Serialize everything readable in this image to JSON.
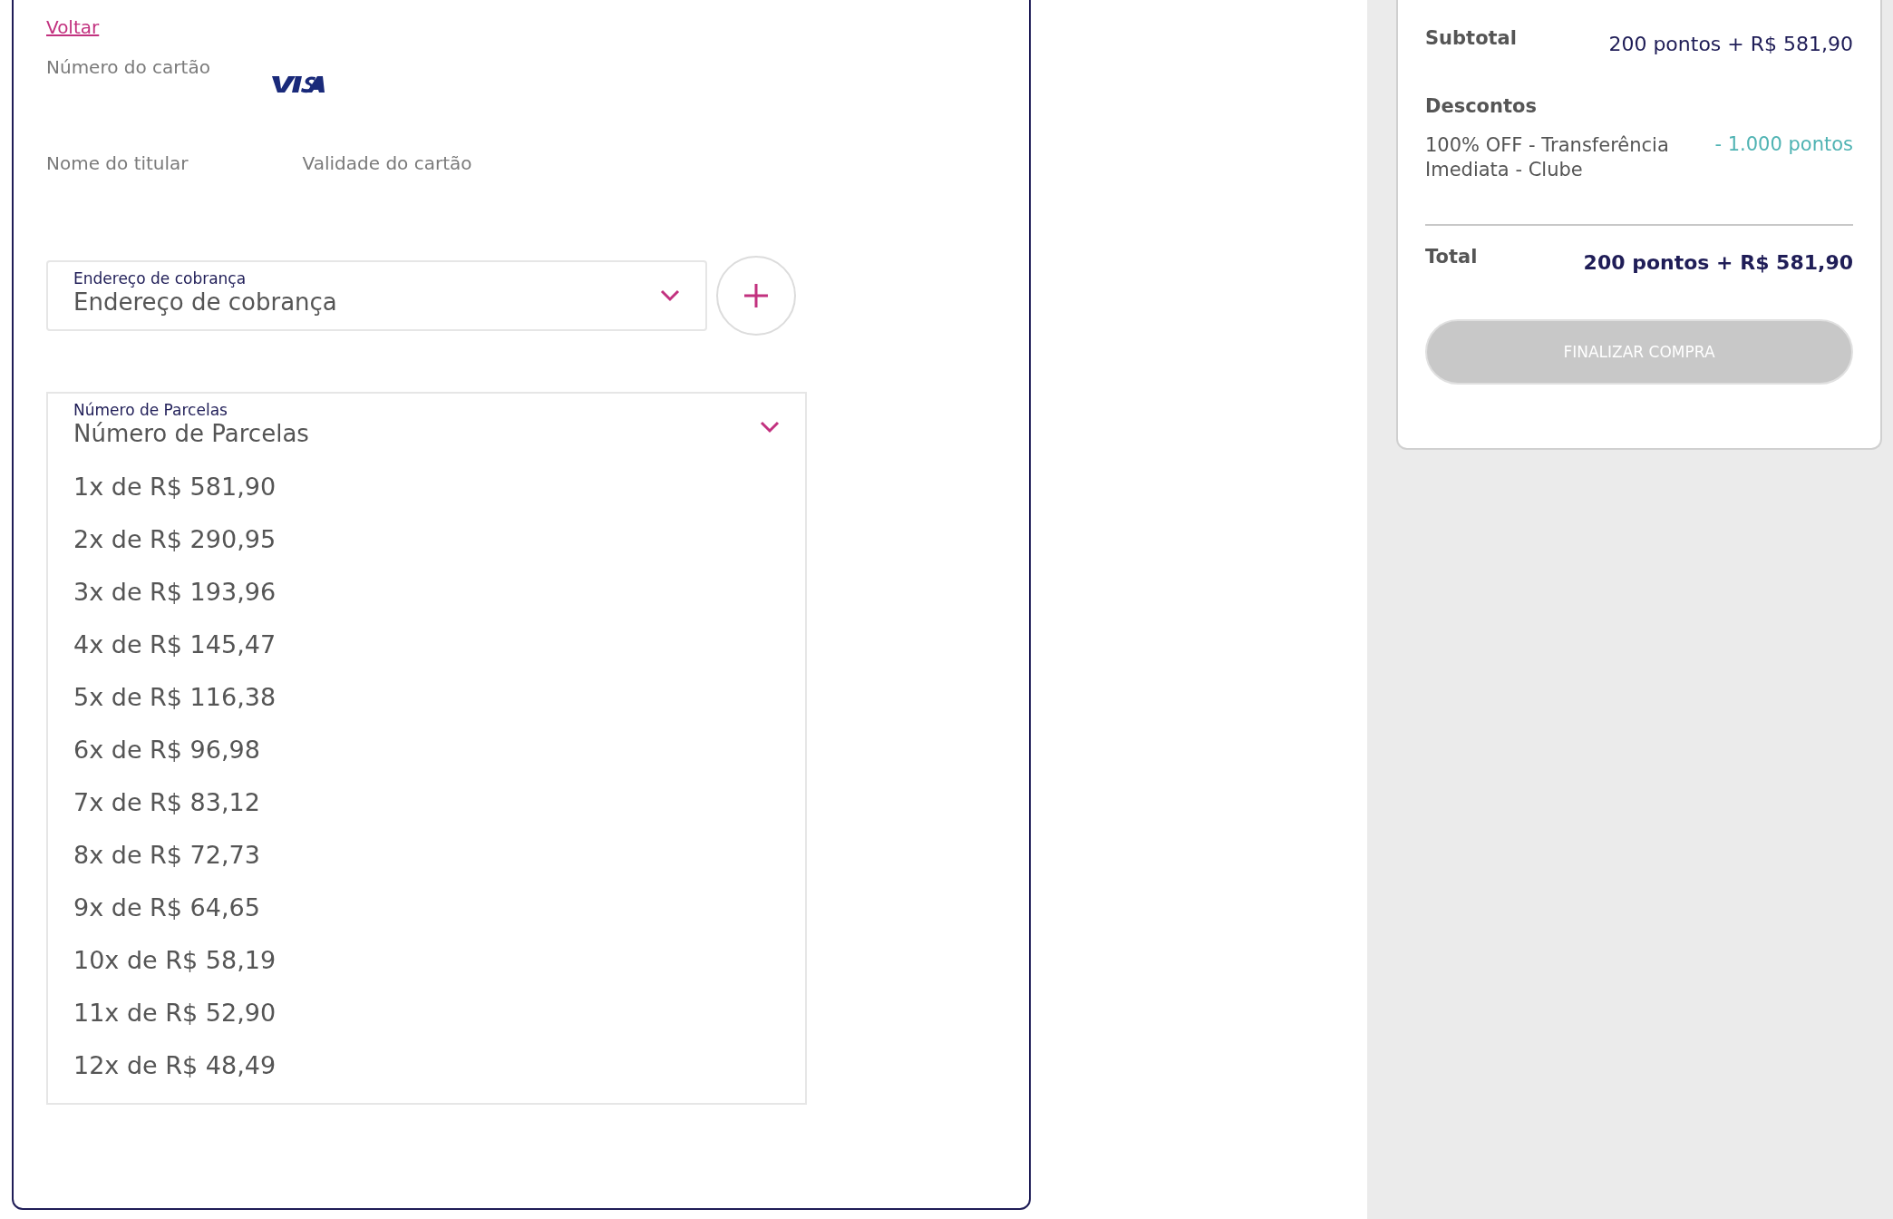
{
  "back_link": "Voltar",
  "card_form": {
    "card_number_label": "Número do cartão",
    "holder_label": "Nome do titular",
    "expiry_label": "Validade do cartão"
  },
  "billing_address": {
    "label": "Endereço de cobrança",
    "value": "Endereço de cobrança"
  },
  "installments": {
    "label": "Número de Parcelas",
    "value": "Número de Parcelas",
    "expanded": true,
    "options": [
      {
        "label": "1x de R$ 581,90"
      },
      {
        "label": "2x de R$ 290,95"
      },
      {
        "label": "3x de R$ 193,96"
      },
      {
        "label": "4x de R$ 145,47"
      },
      {
        "label": "5x de R$ 116,38"
      },
      {
        "label": "6x de R$ 96,98"
      },
      {
        "label": "7x de R$ 83,12"
      },
      {
        "label": "8x de R$ 72,73"
      },
      {
        "label": "9x de R$ 64,65"
      },
      {
        "label": "10x de R$ 58,19"
      },
      {
        "label": "11x de R$ 52,90"
      },
      {
        "label": "12x de R$ 48,49"
      }
    ]
  },
  "summary": {
    "subtotal_label": "Subtotal",
    "subtotal_value": "200 pontos + R$ 581,90",
    "discounts_label": "Descontos",
    "discounts": [
      {
        "name": "100% OFF - Transferência Imediata - Clube",
        "value": "- 1.000 pontos"
      }
    ],
    "total_label": "Total",
    "total_value": "200 pontos + R$ 581,90",
    "checkout_button": {
      "label": "FINALIZAR COMPRA",
      "disabled": true
    }
  }
}
